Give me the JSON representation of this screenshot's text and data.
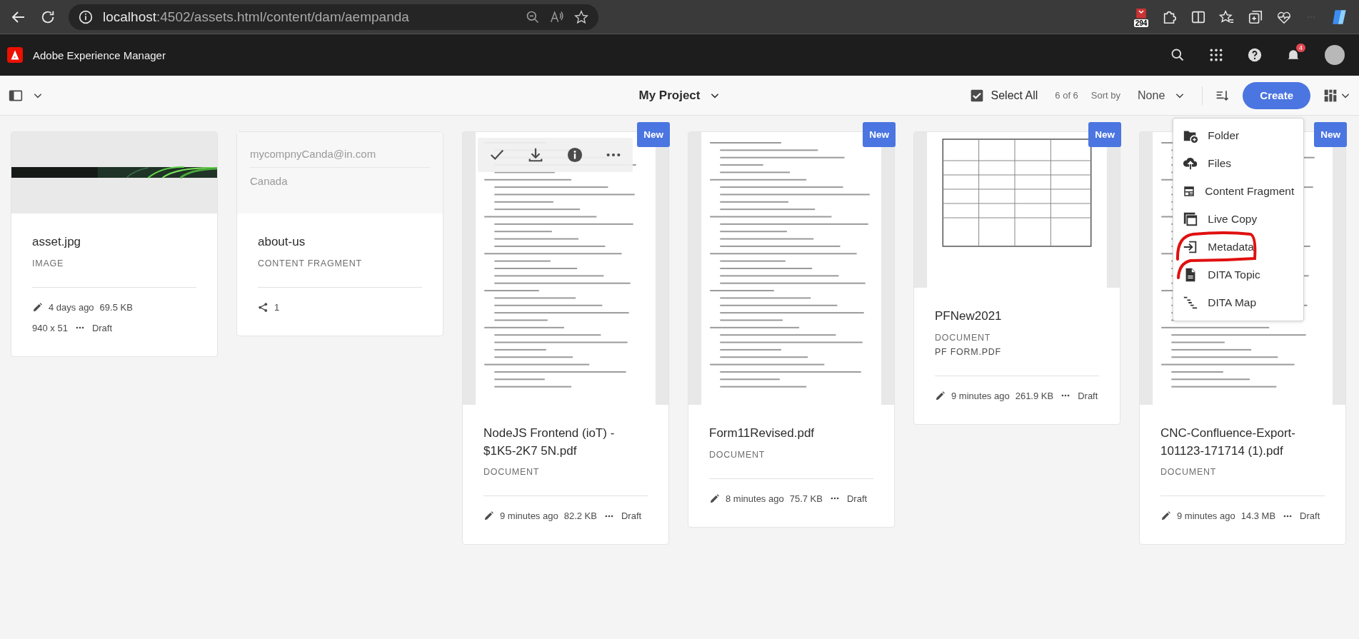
{
  "browser": {
    "url_host": "localhost",
    "url_path": ":4502/assets.html/content/dam/aempanda",
    "extension_badge": "294"
  },
  "header": {
    "title": "Adobe Experience Manager",
    "notification_count": "4"
  },
  "toolbar": {
    "title": "My Project",
    "select_all": "Select All",
    "count": "6 of 6",
    "sort_label": "Sort by",
    "sort_value": "None",
    "create": "Create"
  },
  "create_menu": [
    {
      "label": "Folder",
      "circled": false
    },
    {
      "label": "Files",
      "circled": false
    },
    {
      "label": "Content Fragment",
      "circled": false
    },
    {
      "label": "Live Copy",
      "circled": false
    },
    {
      "label": "Metadata",
      "circled": true
    },
    {
      "label": "DITA Topic",
      "circled": false
    },
    {
      "label": "DITA Map",
      "circled": false
    }
  ],
  "cards": [
    {
      "title": "asset.jpg",
      "type": "IMAGE",
      "modified": "4 days ago",
      "size": "69.5 KB",
      "dimensions": "940 x 51",
      "status": "Draft"
    },
    {
      "kind": "fragment",
      "preview_lines": [
        "mycompnyCanda@in.com",
        "Canada"
      ],
      "title": "about-us",
      "type": "CONTENT FRAGMENT",
      "references": "1"
    },
    {
      "kind": "document",
      "badge": "New",
      "quick_actions": true,
      "title": "NodeJS Frontend (ioT) - $1K5-2K7 5N.pdf",
      "type": "DOCUMENT",
      "modified": "9 minutes ago",
      "size": "82.2 KB",
      "status": "Draft"
    },
    {
      "kind": "document",
      "badge": "New",
      "title": "Form11Revised.pdf",
      "type": "DOCUMENT",
      "modified": "8 minutes ago",
      "size": "75.7 KB",
      "status": "Draft"
    },
    {
      "kind": "document",
      "badge": "New",
      "title": "PFNew2021",
      "type": "DOCUMENT",
      "subtitle": "PF FORM.PDF",
      "modified": "9 minutes ago",
      "size": "261.9 KB",
      "status": "Draft"
    },
    {
      "kind": "document",
      "badge": "New",
      "title": "CNC-Confluence-Export-101123-171714 (1).pdf",
      "type": "DOCUMENT",
      "modified": "9 minutes ago",
      "size": "14.3 MB",
      "status": "Draft"
    }
  ]
}
